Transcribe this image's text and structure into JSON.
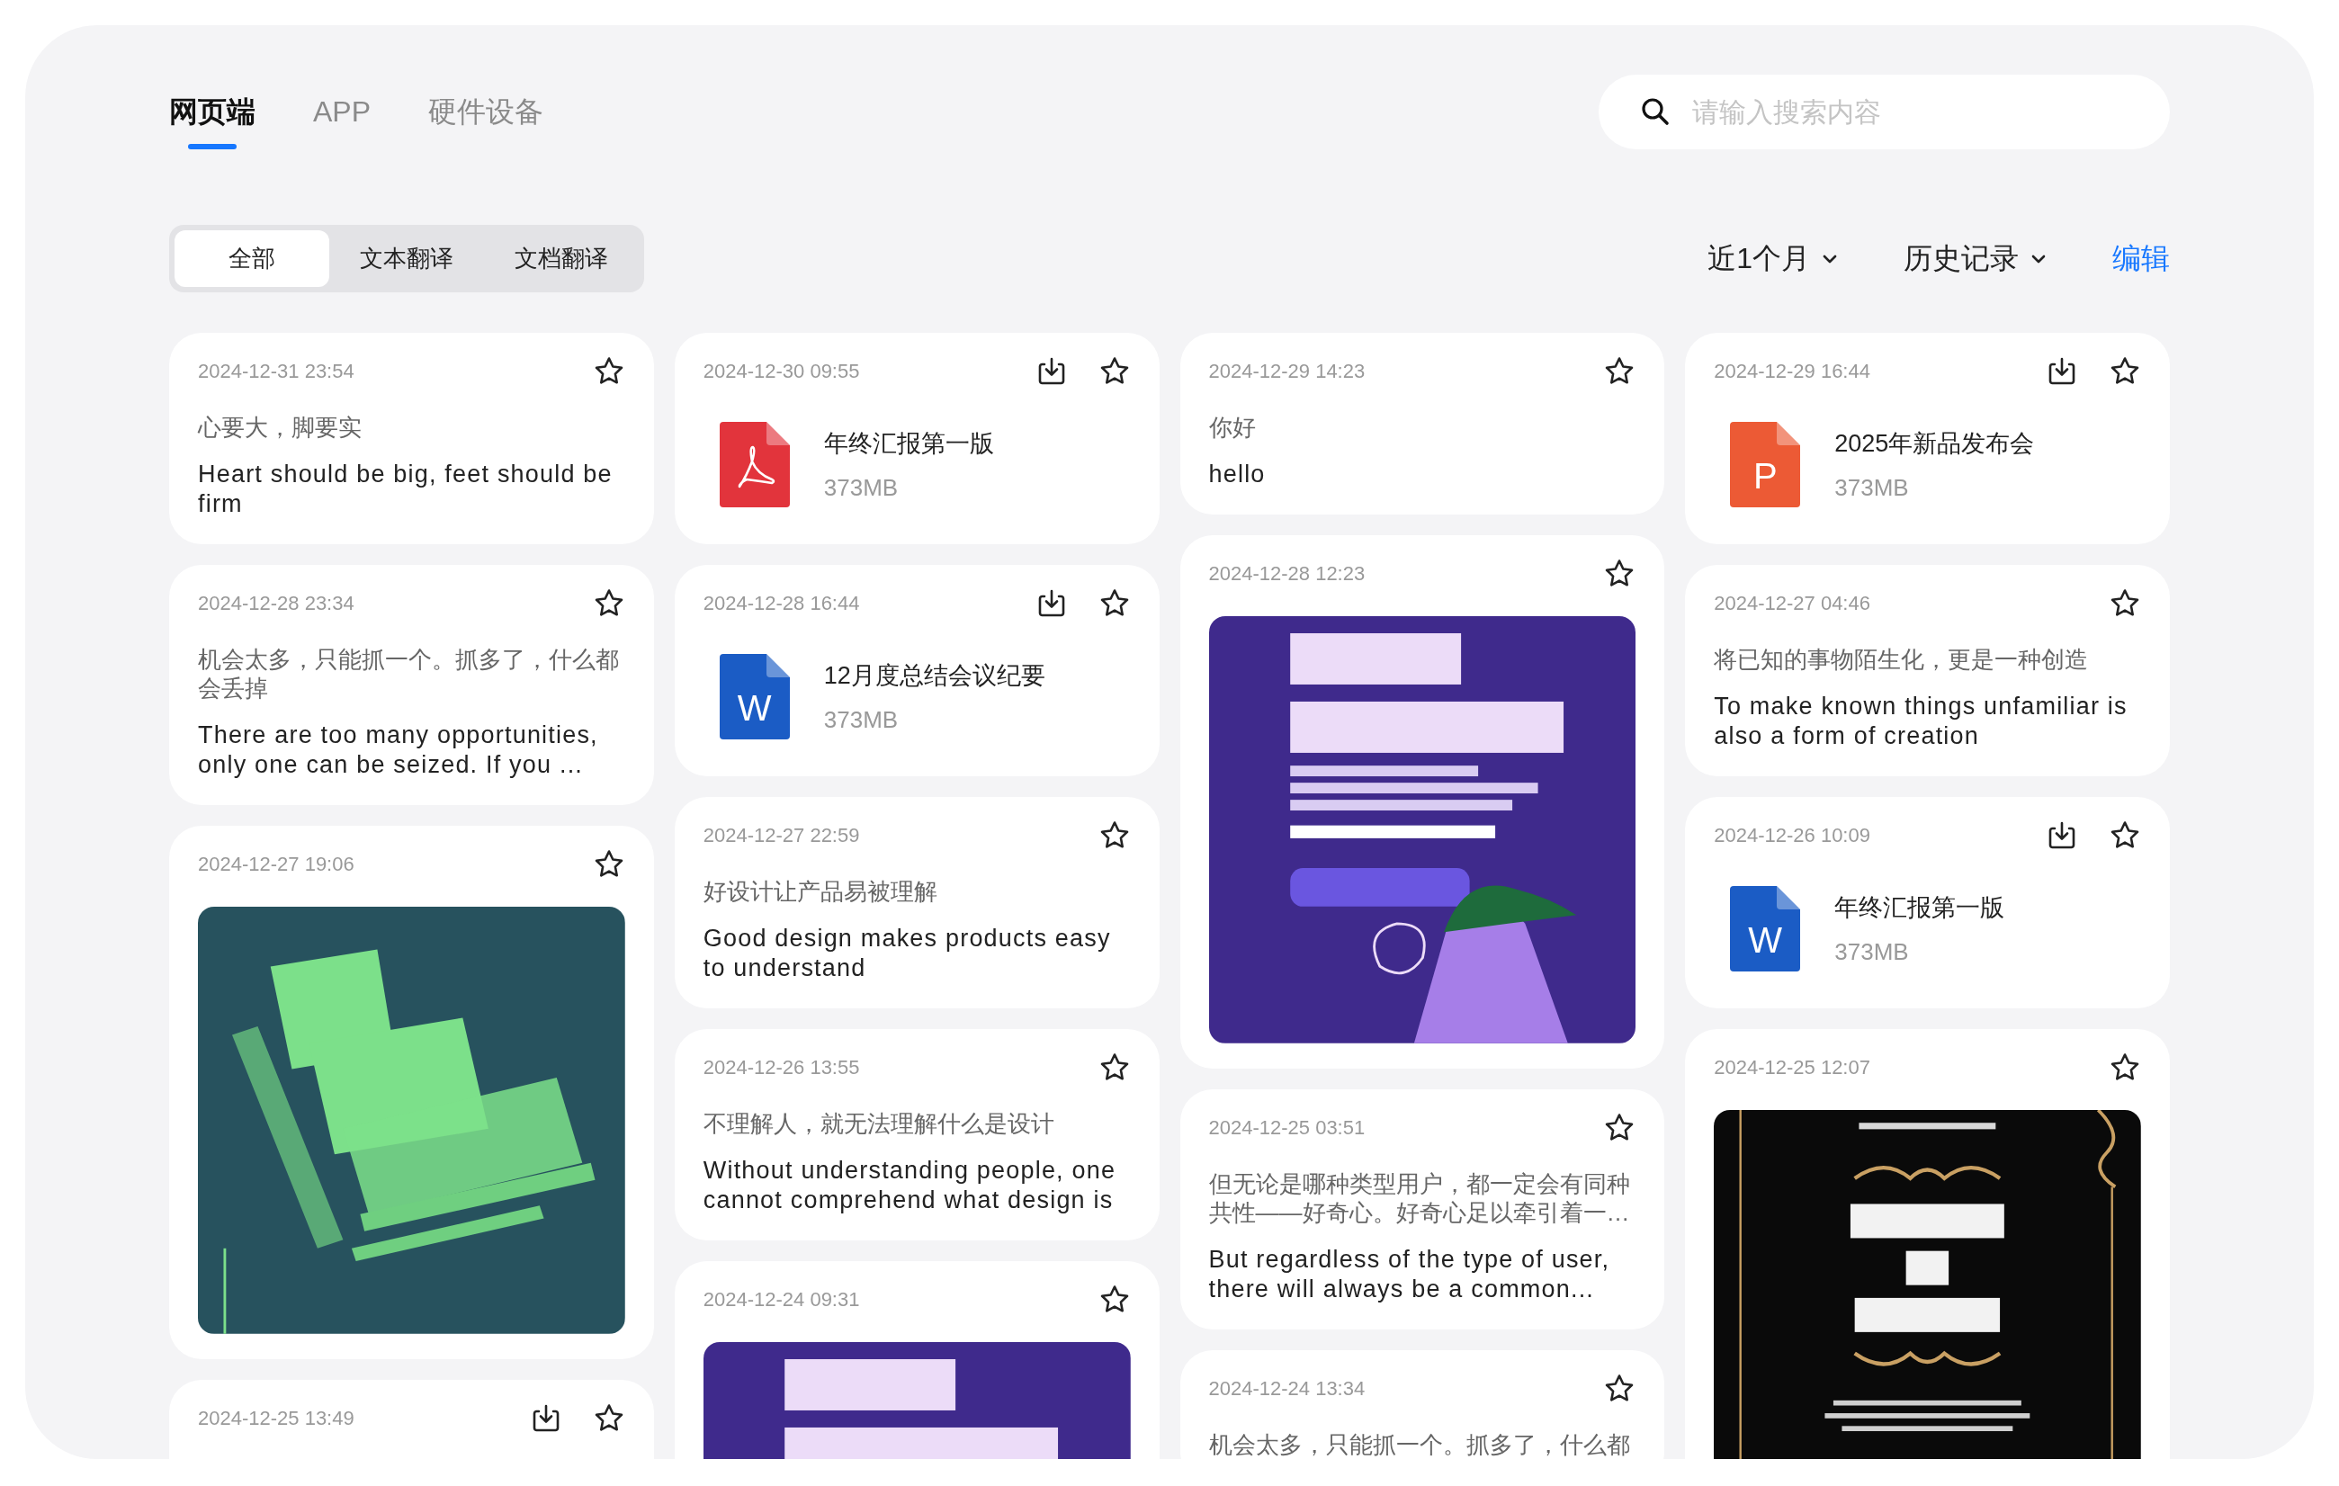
{
  "nav_tabs": [
    {
      "label": "网页端",
      "selected": true
    },
    {
      "label": "APP",
      "selected": false
    },
    {
      "label": "硬件设备",
      "selected": false
    }
  ],
  "search": {
    "placeholder": "请输入搜索内容"
  },
  "segments": [
    {
      "label": "全部",
      "selected": true
    },
    {
      "label": "文本翻译",
      "selected": false
    },
    {
      "label": "文档翻译",
      "selected": false
    }
  ],
  "filters": [
    {
      "label": "近1个月"
    },
    {
      "label": "历史记录"
    }
  ],
  "edit_link": "编辑",
  "columns": [
    {
      "cards": [
        {
          "kind": "text",
          "date": "2024-12-31 23:54",
          "download": false,
          "starred": false,
          "source": "心要大，脚要实",
          "translation": "Heart should be big, feet should be firm"
        },
        {
          "kind": "text",
          "date": "2024-12-28 23:34",
          "download": false,
          "starred": false,
          "source": "机会太多，只能抓一个。抓多了，什么都会丢掉",
          "translation": "There are too many opportunities, only one can be seized. If you ..."
        },
        {
          "date": "2024-12-27 19:06",
          "download": false,
          "starred": false
        },
        {
          "kind": "empty",
          "date": "2024-12-25 13:49",
          "download": true,
          "starred": false
        }
      ]
    },
    {
      "cards": [
        {
          "kind": "file",
          "date": "2024-12-30 09:55",
          "download": true,
          "starred": false,
          "doc_icon": {
            "kind": "pdf"
          },
          "title": "年终汇报第一版",
          "size": "373MB"
        },
        {
          "kind": "file",
          "date": "2024-12-28 16:44",
          "download": true,
          "starred": false,
          "doc_icon": {
            "kind": "word",
            "letter": "W"
          },
          "title": "12月度总结会议纪要",
          "size": "373MB"
        },
        {
          "kind": "text",
          "date": "2024-12-27 22:59",
          "download": false,
          "starred": false,
          "source": "好设计让产品易被理解",
          "translation": "Good design makes products easy to understand"
        },
        {
          "kind": "text",
          "date": "2024-12-26 13:55",
          "download": false,
          "starred": false,
          "source": "不理解人，就无法理解什么是设计",
          "translation": "Without understanding people, one cannot comprehend what design is"
        },
        {
          "date": "2024-12-24 09:31",
          "download": false,
          "starred": false
        }
      ]
    },
    {
      "cards": [
        {
          "kind": "text",
          "date": "2024-12-29 14:23",
          "download": false,
          "starred": false,
          "source": "你好",
          "translation": "hello"
        },
        {
          "date": "2024-12-28 12:23",
          "download": false,
          "starred": false
        },
        {
          "kind": "text",
          "date": "2024-12-25 03:51",
          "download": false,
          "starred": false,
          "source": "但无论是哪种类型用户，都一定会有同种共性——好奇心。好奇心足以牵引着一…",
          "translation": "But regardless of the type of user, there will always be a common..."
        },
        {
          "kind": "text",
          "date": "2024-12-24 13:34",
          "download": false,
          "starred": false,
          "source": "机会太多，只能抓一个。抓多了，什么都"
        }
      ]
    },
    {
      "cards": [
        {
          "kind": "file",
          "date": "2024-12-29 16:44",
          "download": true,
          "starred": false,
          "doc_icon": {
            "kind": "ppt",
            "letter": "P"
          },
          "title": "2025年新品发布会",
          "size": "373MB"
        },
        {
          "kind": "text",
          "date": "2024-12-27 04:46",
          "download": false,
          "starred": false,
          "source": "将已知的事物陌生化，更是一种创造",
          "translation": "To make known things unfamiliar is also a form of creation"
        },
        {
          "kind": "file",
          "date": "2024-12-26 10:09",
          "download": true,
          "starred": false,
          "doc_icon": {
            "kind": "word",
            "letter": "W"
          },
          "title": "年终汇报第一版",
          "size": "373MB"
        },
        {
          "date": "2024-12-25 12:07",
          "download": false,
          "starred": false
        }
      ]
    }
  ]
}
